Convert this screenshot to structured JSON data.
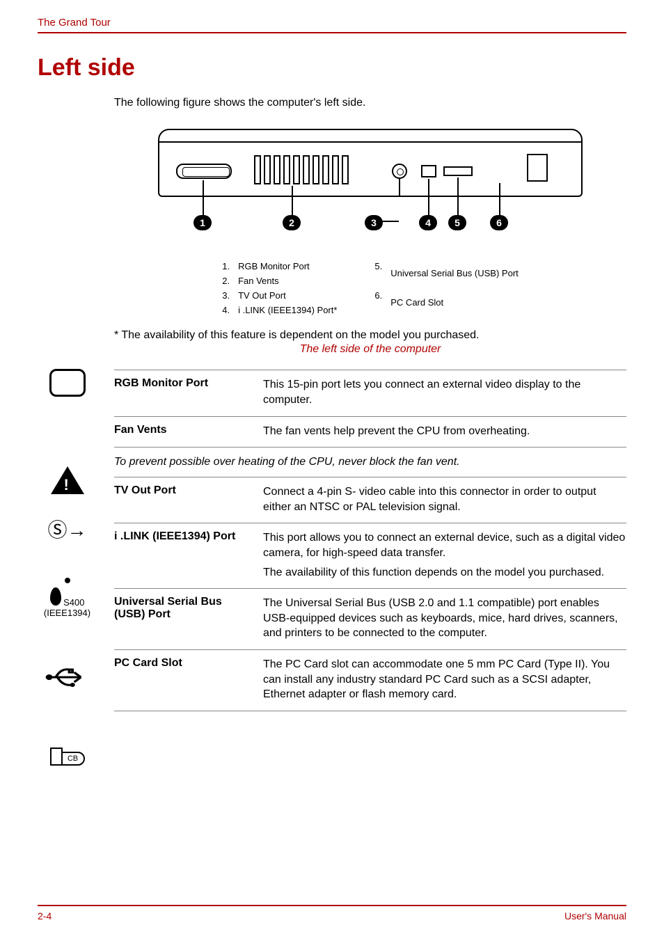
{
  "header": {
    "breadcrumb": "The Grand Tour"
  },
  "title": "Left side",
  "intro": "The following figure shows the computer's left side.",
  "diagram": {
    "callouts": [
      "1",
      "2",
      "3",
      "4",
      "5",
      "6"
    ],
    "legend_left": [
      {
        "n": "1.",
        "t": "RGB Monitor Port"
      },
      {
        "n": "2.",
        "t": "Fan Vents"
      },
      {
        "n": "3.",
        "t": "TV Out Port"
      },
      {
        "n": "4.",
        "t": "i .LINK (IEEE1394) Port*"
      }
    ],
    "legend_right": [
      {
        "n": "5.",
        "t": "Universal Serial Bus (USB) Port"
      },
      {
        "n": "6.",
        "t": "PC Card Slot"
      }
    ]
  },
  "footnote": "* The availability of this feature is dependent on the model you purchased.",
  "figcaption": "The left side of the computer",
  "rows": {
    "rgb": {
      "term": "RGB Monitor Port",
      "desc": "This 15-pin port lets you connect an external video display to the computer."
    },
    "fan": {
      "term": "Fan Vents",
      "desc": "The fan vents help prevent the CPU from overheating."
    },
    "note": "To prevent possible over heating of the CPU, never block the fan vent.",
    "tv": {
      "term": "TV Out Port",
      "desc": "Connect a 4-pin S- video cable into this connector in order to output either an NTSC or PAL television signal."
    },
    "ilink": {
      "term": "i .LINK (IEEE1394) Port",
      "desc1": "This port allows you to connect an external device, such as a digital video camera, for high-speed data transfer.",
      "desc2": "The availability of this function depends on the model you purchased."
    },
    "usb": {
      "term": "Universal Serial Bus (USB) Port",
      "desc": "The Universal Serial Bus (USB 2.0 and 1.1 compatible) port enables USB-equipped devices such as keyboards, mice, hard drives, scanners, and printers to be connected to the computer."
    },
    "pc": {
      "term": "PC Card Slot",
      "desc": "The PC Card slot can accommodate one 5 mm PC Card (Type II). You can install any industry standard PC Card such as a SCSI adapter, Ethernet adapter or flash memory card."
    }
  },
  "marginlabels": {
    "ilink_a": "S400",
    "ilink_b": "(IEEE1394)",
    "pc": "CB"
  },
  "tv_glyph": "Ⓢ→",
  "footer": {
    "page": "2-4",
    "doc": "User's Manual"
  }
}
